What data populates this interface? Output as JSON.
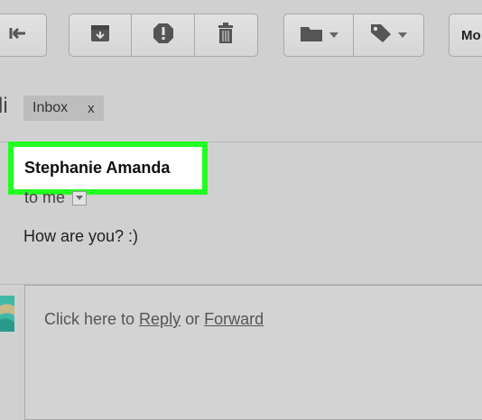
{
  "toolbar": {
    "back": {
      "icon": "back-arrow-icon"
    },
    "actions": [
      {
        "icon": "archive-icon"
      },
      {
        "icon": "report-spam-icon"
      },
      {
        "icon": "trash-icon"
      }
    ],
    "move": {
      "icon": "folder-icon"
    },
    "labels": {
      "icon": "tag-icon"
    },
    "more_label": "Mo"
  },
  "header": {
    "subject_fragment": "li",
    "label_chip": {
      "text": "Inbox",
      "remove": "x"
    }
  },
  "message": {
    "sender": "Stephanie Amanda",
    "recipient": "to me",
    "body": "How are you? :)"
  },
  "reply": {
    "prefix": "Click here to ",
    "reply_link": "Reply",
    "middle": " or ",
    "forward_link": "Forward"
  },
  "colors": {
    "highlight": "#22ff22",
    "background": "#d0d0d0"
  }
}
